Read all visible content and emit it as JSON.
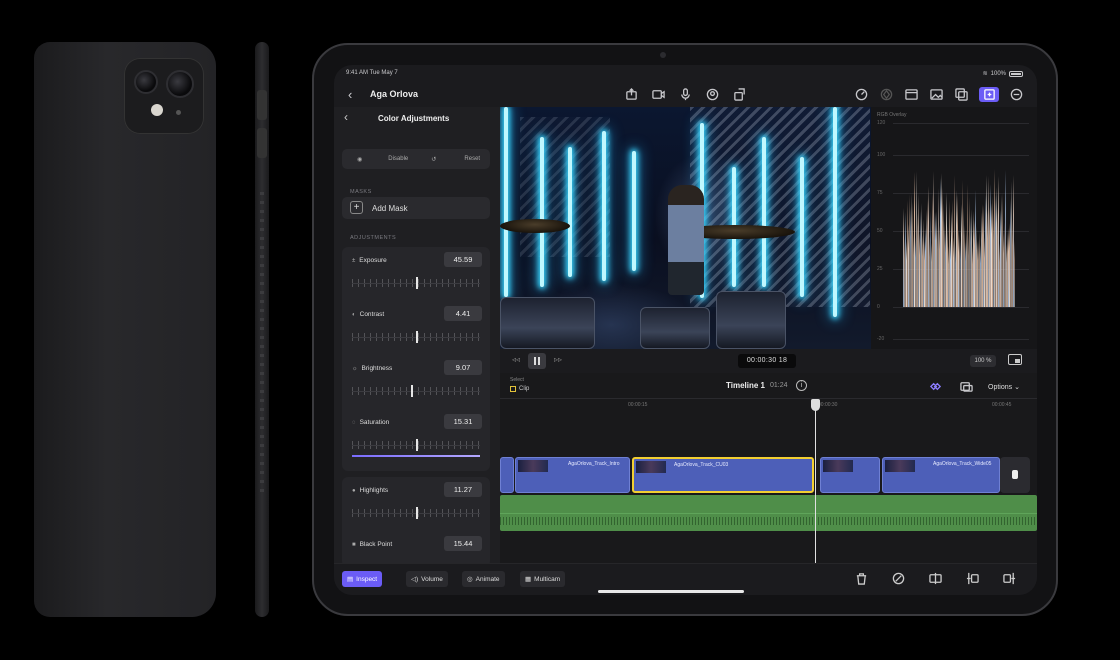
{
  "status_bar": {
    "time": "9:41 AM  Tue May 7",
    "battery": "100%"
  },
  "toolbar": {
    "project_title": "Aga Orlova",
    "center_icons": [
      "export-icon",
      "camera-icon",
      "microphone-icon",
      "voiceover-icon",
      "share-icon"
    ],
    "right_icons": [
      "speed-icon",
      "keyframe-icon",
      "viewer-layout-icon",
      "photos-icon",
      "browser-icon",
      "inspector-icon",
      "more-icon"
    ]
  },
  "inspector": {
    "title": "Color Adjustments",
    "toggle_labels": [
      "Disable",
      "Reset"
    ],
    "masks_label": "MASKS",
    "add_mask_label": "Add Mask",
    "adjustments_label": "ADJUSTMENTS",
    "adjustments": [
      {
        "name": "Exposure",
        "value": "45.59",
        "level": 0.5
      },
      {
        "name": "Contrast",
        "value": "4.41",
        "level": 0.5
      },
      {
        "name": "Brightness",
        "value": "9.07",
        "level": 0.46
      },
      {
        "name": "Saturation",
        "value": "15.31",
        "level": 0.5
      },
      {
        "name": "Highlights",
        "value": "11.27",
        "level": 0.5
      },
      {
        "name": "Black Point",
        "value": "15.44",
        "level": 0.5
      }
    ]
  },
  "scope": {
    "label": "RGB Overlay",
    "scale": [
      "120",
      "100",
      "75",
      "50",
      "25",
      "0",
      "-20"
    ]
  },
  "transport": {
    "timecode": "00:00:30 18",
    "zoom": "100 %"
  },
  "timeline": {
    "selected_label": "Select",
    "clip_label": "Clip",
    "title": "Timeline 1",
    "duration": "01:24",
    "options_label": "Options",
    "ruler": [
      "00:00:15",
      "00:00:30",
      "00:00:45"
    ],
    "clips": [
      {
        "name": "AgaOrlova_Track_Intro",
        "selected": false
      },
      {
        "name": "AgaOrlova_Track_CU03",
        "selected": true
      },
      {
        "name": "",
        "selected": false
      },
      {
        "name": "AgaOrlova_Track_Wide05",
        "selected": false
      }
    ]
  },
  "bottom_bar": {
    "buttons": [
      "Inspect",
      "Volume",
      "Animate",
      "Multicam"
    ],
    "right_icons": [
      "trash-icon",
      "disable-icon",
      "split-icon",
      "trim-start-icon",
      "trim-end-icon"
    ]
  },
  "colors": {
    "accent": "#6b5cf6",
    "video_clip": "#4d5fb8",
    "audio_clip": "#4f8e49",
    "selection": "#f2cf32"
  }
}
